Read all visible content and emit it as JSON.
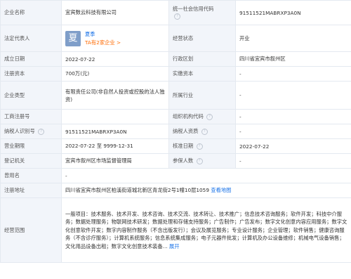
{
  "rows": {
    "r1": {
      "l1": "企业名称",
      "v1": "宜宾数云科技有限公司",
      "l2": "统一社会信用代码",
      "v2": "91511521MABRXP3A0N"
    },
    "r2": {
      "l1": "法定代表人",
      "avatar": "夏",
      "rep_name": "夏季",
      "rep_sub": "TA有2家企业 >",
      "l2": "经营状态",
      "v2": "开业"
    },
    "r3": {
      "l1": "成立日期",
      "v1": "2022-07-22",
      "l2": "行政区划",
      "v2": "四川省宜宾市叙州区"
    },
    "r4": {
      "l1": "注册资本",
      "v1": "700万(元)",
      "l2": "实缴资本",
      "v2": "-"
    },
    "r5": {
      "l1": "企业类型",
      "v1": "有限责任公司(非自然人投资或控股的法人独资)",
      "l2": "所属行业",
      "v2": "-"
    },
    "r6": {
      "l1": "工商注册号",
      "v1": "",
      "l2": "组织机构代码",
      "v2": "-"
    },
    "r7": {
      "l1": "纳税人识别号",
      "v1": "91511521MABRXP3A0N",
      "l2": "纳税人资质",
      "v2": "-"
    },
    "r8": {
      "l1": "营业期限",
      "v1": "2022-07-22 至 9999-12-31",
      "l2": "核准日期",
      "v2": "2022-07-22"
    },
    "r9": {
      "l1": "登记机关",
      "v1": "宜宾市叙州区市场监督管理局",
      "l2": "参保人数",
      "v2": "-"
    },
    "r10": {
      "l1": "曾用名",
      "v1": "-"
    },
    "r11": {
      "l1": "注册地址",
      "v1": "四川省宜宾市叙州区柏溪街道城北新区青龙街2号1幢10层1059",
      "link": "查看地图"
    },
    "r12": {
      "l1": "经营范围",
      "v1": "一般项目：技术服务、技术开发、技术咨询、技术交流、技术转让、技术推广；信息技术咨询服务；软件开发；科技中介服务；数据处理服务；物联网技术研发；数据处理和存储支持服务；广告制作；广告发布；数字文化创意内容应用服务；数字文化创意软件开发；数字内容制作服务（不含出版发行）；会议及展览服务；专业设计服务；企业管理；软件销售；健康咨询服务（不含诊疗服务）；计算机系统服务；信息系统集成服务；电子元器件批发；计算机及办公设备维修；机械电气设备销售；文化用品设备出租；数字文化创意技术装备... ",
      "more": "展开"
    }
  }
}
